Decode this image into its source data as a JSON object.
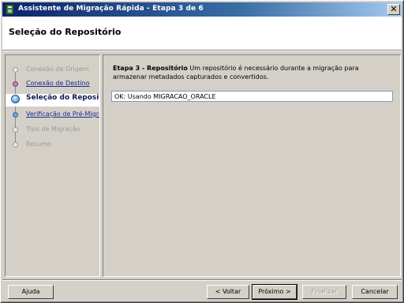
{
  "window": {
    "title": "Assistente de Migração Rápida - Etapa 3 de 6",
    "close_glyph": "✕",
    "icon": "app-wizard-icon"
  },
  "header": {
    "title": "Seleção do Repositório"
  },
  "steps": [
    {
      "label": "Conexão de Origem",
      "state": "disabled"
    },
    {
      "label": "Conexão de Destino",
      "state": "done"
    },
    {
      "label": "Seleção do Repositório",
      "state": "current"
    },
    {
      "label": "Verificação de Pré-Migração",
      "state": "next"
    },
    {
      "label": "Tipo de Migração",
      "state": "disabled"
    },
    {
      "label": "Resumo",
      "state": "disabled"
    }
  ],
  "content": {
    "step_heading": "Etapa 3 - Repositório",
    "description": " Um repositório é necessário durante a migração para armazenar metadados capturados e convertidos.",
    "status_value": "OK: Usando MIGRACAO_ORACLE"
  },
  "buttons": {
    "help": "Ajuda",
    "back": "< Voltar",
    "next": "Próximo >",
    "finish": "Finalizar",
    "cancel": "Cancelar"
  },
  "colors": {
    "titlebar_start": "#0a246a",
    "titlebar_end": "#a6caf0",
    "face": "#d4d0c8",
    "link": "#1a2a8a"
  }
}
